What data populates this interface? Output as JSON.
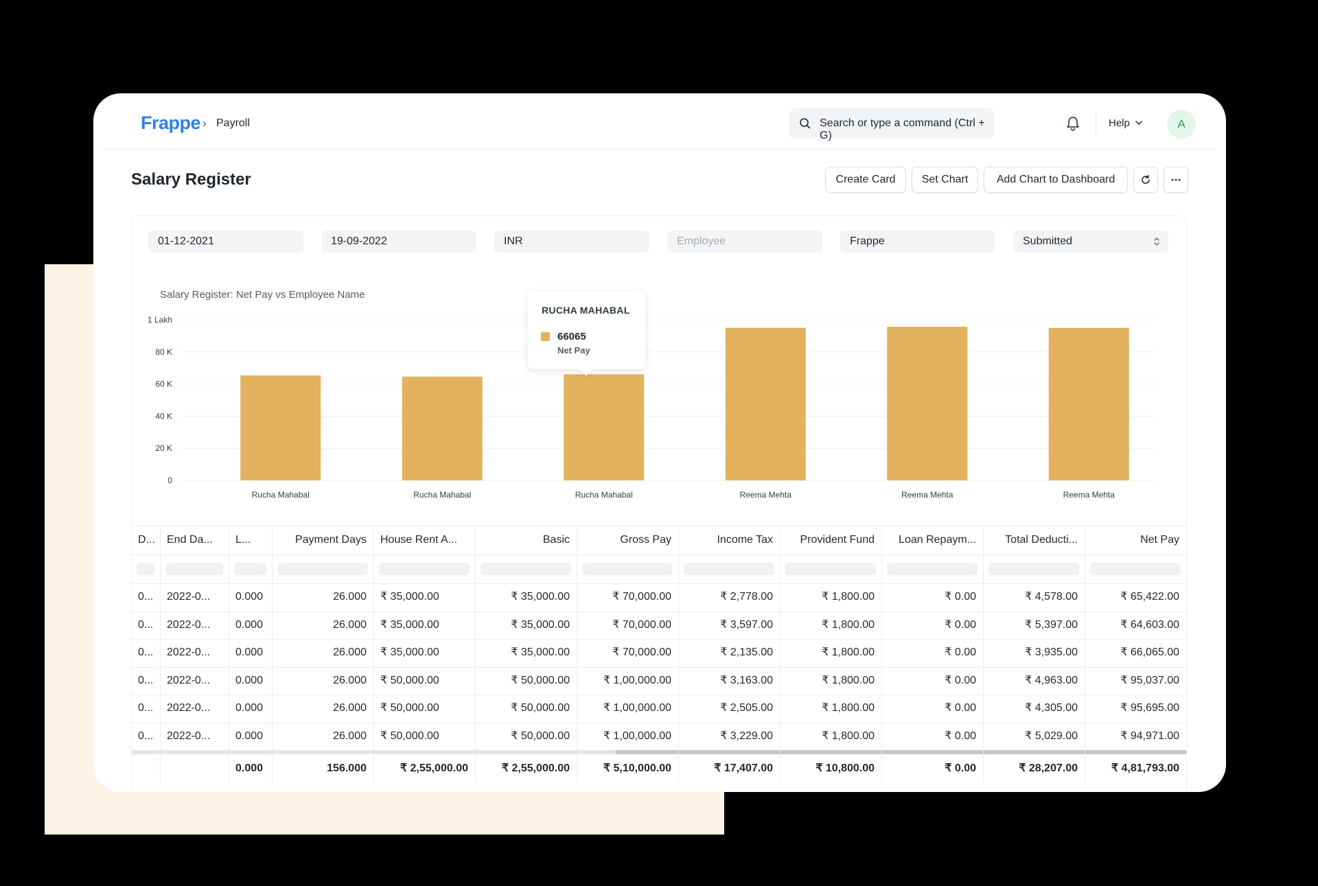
{
  "navbar": {
    "logo": "Frappe",
    "breadcrumb": "Payroll",
    "search_placeholder": "Search or type a command (Ctrl + G)",
    "help_label": "Help",
    "avatar_letter": "A"
  },
  "page": {
    "title": "Salary Register",
    "buttons": {
      "create_card": "Create Card",
      "set_chart": "Set Chart",
      "add_chart": "Add Chart to Dashboard"
    }
  },
  "filters": {
    "from_date": "01-12-2021",
    "to_date": "19-09-2022",
    "currency": "INR",
    "employee_placeholder": "Employee",
    "company": "Frappe",
    "docstatus": "Submitted"
  },
  "chart_data": {
    "type": "bar",
    "title": "Salary Register: Net Pay vs Employee Name",
    "categories": [
      "Rucha Mahabal",
      "Rucha Mahabal",
      "Rucha Mahabal",
      "Reema Mehta",
      "Reema Mehta",
      "Reema Mehta"
    ],
    "series": [
      {
        "name": "Net Pay",
        "values": [
          65422,
          64603,
          66065,
          95037,
          95695,
          94971
        ]
      }
    ],
    "ylim": [
      0,
      100000
    ],
    "y_ticks": [
      {
        "value": 0,
        "label": "0"
      },
      {
        "value": 20000,
        "label": "20 K"
      },
      {
        "value": 40000,
        "label": "40 K"
      },
      {
        "value": 60000,
        "label": "60 K"
      },
      {
        "value": 80000,
        "label": "80 K"
      },
      {
        "value": 100000,
        "label": "1 Lakh"
      }
    ],
    "color": "#e2b25e",
    "grid": true
  },
  "tooltip": {
    "title": "RUCHA MAHABAL",
    "value": "66065",
    "label": "Net Pay"
  },
  "table": {
    "columns": [
      "D...",
      "End Da...",
      "L...",
      "Payment Days",
      "House Rent A...",
      "Basic",
      "Gross Pay",
      "Income Tax",
      "Provident Fund",
      "Loan Repaym...",
      "Total Deducti...",
      "Net Pay"
    ],
    "rows": [
      [
        "0...",
        "2022-0...",
        "0.000",
        "26.000",
        "₹ 35,000.00",
        "₹ 35,000.00",
        "₹ 70,000.00",
        "₹ 2,778.00",
        "₹ 1,800.00",
        "₹ 0.00",
        "₹ 4,578.00",
        "₹ 65,422.00"
      ],
      [
        "0...",
        "2022-0...",
        "0.000",
        "26.000",
        "₹ 35,000.00",
        "₹ 35,000.00",
        "₹ 70,000.00",
        "₹ 3,597.00",
        "₹ 1,800.00",
        "₹ 0.00",
        "₹ 5,397.00",
        "₹ 64,603.00"
      ],
      [
        "0...",
        "2022-0...",
        "0.000",
        "26.000",
        "₹ 35,000.00",
        "₹ 35,000.00",
        "₹ 70,000.00",
        "₹ 2,135.00",
        "₹ 1,800.00",
        "₹ 0.00",
        "₹ 3,935.00",
        "₹ 66,065.00"
      ],
      [
        "0...",
        "2022-0...",
        "0.000",
        "26.000",
        "₹ 50,000.00",
        "₹ 50,000.00",
        "₹ 1,00,000.00",
        "₹ 3,163.00",
        "₹ 1,800.00",
        "₹ 0.00",
        "₹ 4,963.00",
        "₹ 95,037.00"
      ],
      [
        "0...",
        "2022-0...",
        "0.000",
        "26.000",
        "₹ 50,000.00",
        "₹ 50,000.00",
        "₹ 1,00,000.00",
        "₹ 2,505.00",
        "₹ 1,800.00",
        "₹ 0.00",
        "₹ 4,305.00",
        "₹ 95,695.00"
      ],
      [
        "0...",
        "2022-0...",
        "0.000",
        "26.000",
        "₹ 50,000.00",
        "₹ 50,000.00",
        "₹ 1,00,000.00",
        "₹ 3,229.00",
        "₹ 1,800.00",
        "₹ 0.00",
        "₹ 5,029.00",
        "₹ 94,971.00"
      ]
    ],
    "totals": [
      "",
      "",
      "0.000",
      "156.000",
      "₹ 2,55,000.00",
      "₹ 2,55,000.00",
      "₹ 5,10,000.00",
      "₹ 17,407.00",
      "₹ 10,800.00",
      "₹ 0.00",
      "₹ 28,207.00",
      "₹ 4,81,793.00"
    ]
  }
}
